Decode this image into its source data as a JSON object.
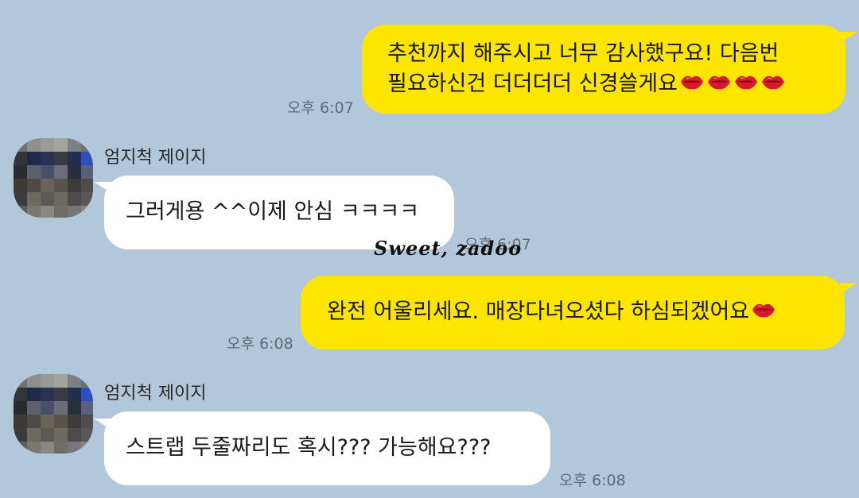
{
  "messages": [
    {
      "sender": "me",
      "line1": "추천까지 해주시고 너무 감사했구요! 다음번",
      "line2": "필요하신건 더더더더 신경쓸게요",
      "time": "오후 6:07",
      "emoji": "lips-icon",
      "emoji_count": 4
    },
    {
      "sender": "other",
      "name": "엄지척 제이지",
      "text": "그러게용 ^^이제 안심 ㅋㅋㅋㅋ",
      "time": "오후 6:07"
    },
    {
      "sender": "me",
      "text": "완전 어울리세요. 매장다녀오셨다 하심되겠어요",
      "time": "오후 6:08",
      "emoji": "lips-icon",
      "emoji_count": 1
    },
    {
      "sender": "other",
      "name": "엄지척 제이지",
      "text": "스트랩 두줄짜리도 혹시??? 가능해요???",
      "time": "오후 6:08"
    }
  ],
  "watermark": "Sweet, zadoo",
  "colors": {
    "background": "#b2c7d9",
    "my_bubble": "#fee500",
    "other_bubble": "#ffffff",
    "lips": "#d9182a"
  }
}
